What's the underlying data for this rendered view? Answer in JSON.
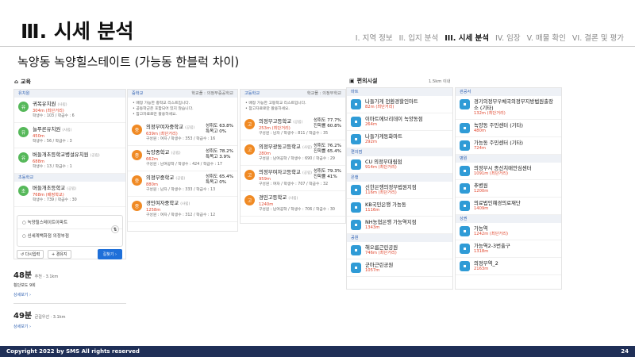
{
  "header": {
    "title": "Ⅲ. 시세 분석",
    "subtitle": "녹양동 녹양힐스테이트 (가능동 한블럭 차이)"
  },
  "nav": [
    "I. 지역 정보",
    "II. 입지 분석",
    "III. 시세 분석",
    "IV. 임장",
    "V. 매물 확인",
    "VI. 결론 및 평가"
  ],
  "edu": {
    "label": "교육",
    "kinder_label": "유치원",
    "schools": [
      {
        "name": "귀복유치원",
        "tag": "(사립)",
        "dist": "304m",
        "ex": "(최단거리)",
        "meta": "학생수 : 103 / 학급수 : 6"
      },
      {
        "name": "늘푸른유치원",
        "tag": "(사립)",
        "dist": "450m",
        "meta": "학생수 : 56 / 학급수 : 3"
      },
      {
        "name": "버들개초등학교병설유치원",
        "tag": "(공립)",
        "dist": "688m",
        "meta": "학생수 : 13 / 학급수 : 1"
      }
    ],
    "elem_label": "초등학교",
    "elem": {
      "name": "버들개초등학교",
      "tag": "(공립)",
      "dist": "768m",
      "ex": "(배정학교)",
      "meta": "학생수 : 739 / 학급수 : 30"
    }
  },
  "route": {
    "from": "녹양힐스테이트아파트",
    "to": "신세계백화점 의정부점",
    "b1": "다시입력",
    "b2": "경유지",
    "go": "길찾기 ›",
    "r1": "48분",
    "r1sub": "추천 · 3.1km",
    "r1d1": "횡단보도 9회",
    "r1d2": "상세보기 ›",
    "r2": "49분",
    "r2sub": "큰길우선 · 3.1km",
    "r2d": "상세보기 ›"
  },
  "middle": {
    "label": "중학교",
    "right": "학교폴 : 의정부중공학교",
    "notes": [
      "배정 가능한 중학교 리스트입니다.",
      "공동학군은 포함되어 있지 않습니다.",
      "참고자료로만 활용하세요."
    ],
    "items": [
      {
        "name": "의정부여자중학교",
        "tag": "(공립)",
        "dist": "639m",
        "ex": "(최단거리)",
        "meta": "구성원 : 여자 / 학생수 : 353 / 학급수 : 16",
        "r1": "성취도 63.8%",
        "r2": "특목고 0%"
      },
      {
        "name": "녹양중학교",
        "tag": "(공립)",
        "dist": "662m",
        "meta": "구성원 : 남여공학 / 학생수 : 424 / 학급수 : 17",
        "r1": "성취도 78.2%",
        "r2": "특목고 3.9%"
      },
      {
        "name": "의정부중학교",
        "tag": "(공립)",
        "dist": "880m",
        "meta": "구성원 : 남자 / 학생수 : 333 / 학급수 : 13",
        "r1": "성취도 65.4%",
        "r2": "특목고 0%"
      },
      {
        "name": "경민여자중학교",
        "tag": "(사립)",
        "dist": "1258m",
        "meta": "구성원 : 여자 / 학생수 : 312 / 학급수 : 12"
      }
    ]
  },
  "high": {
    "label": "고등학교",
    "right": "학교폴 : 의정부학교",
    "notes": [
      "배정 가능한 고등학교 리스트입니다.",
      "참고자료로만 활용하세요."
    ],
    "items": [
      {
        "name": "의정부고등학교",
        "tag": "(공립)",
        "dist": "253m",
        "ex": "(최단거리)",
        "meta": "구성원 : 남자 / 학생수 : 811 / 학급수 : 35",
        "r1": "성취도 77.7%",
        "r2": "진학률 60.8%"
      },
      {
        "name": "의정부광동고등학교",
        "tag": "(사립)",
        "dist": "280m",
        "meta": "구성원 : 남여공학 / 학생수 : 690 / 학급수 : 29",
        "r1": "성취도 76.2%",
        "r2": "진학률 65.4%"
      },
      {
        "name": "의정부여자고등학교",
        "tag": "(공립)",
        "dist": "959m",
        "meta": "구성원 : 여자 / 학생수 : 707 / 학급수 : 32",
        "r1": "성취도 79.3%",
        "r2": "진학률 41%"
      },
      {
        "name": "경민고등학교",
        "tag": "(사립)",
        "dist": "1240m",
        "meta": "구성원 : 남여공학 / 학생수 : 706 / 학급수 : 30"
      }
    ]
  },
  "amen": {
    "label": "편의시설",
    "range": "1.5km 이내",
    "c1": [
      {
        "cat": "마트"
      },
      {
        "name": "나들가게 천환경할인마트",
        "dist": "82m",
        "ex": "(최단거리)"
      },
      {
        "name": "이마트에브리데이 녹양동점",
        "dist": "264m"
      },
      {
        "name": "나들가게동화마트",
        "dist": "292m"
      },
      {
        "cat": "편의점"
      },
      {
        "name": "CU 의정부대림점",
        "dist": "914m",
        "ex": "(최단거리)"
      },
      {
        "cat": "은행"
      },
      {
        "name": "신한은행의정부법원지점",
        "dist": "116m",
        "ex": "(최단거리)"
      },
      {
        "name": "KB국민은행 가능동",
        "dist": "1116m"
      },
      {
        "name": "NH농협은행 가능역지점",
        "dist": "1343m"
      },
      {
        "cat": "공원"
      },
      {
        "name": "해오름근린공원",
        "dist": "746m",
        "ex": "(최단거리)"
      },
      {
        "name": "군마근린공원",
        "dist": "1057m"
      }
    ],
    "c2": [
      {
        "cat": "관공서"
      },
      {
        "name": "경기의정부우체국의정부지방법원출장소 (기타)",
        "dist": "132m",
        "ex": "(최단거리)"
      },
      {
        "name": "녹양동 주민센터 (기타)",
        "dist": "480m"
      },
      {
        "name": "가능동 주민센터 (기타)",
        "dist": "724m"
      },
      {
        "cat": "병원"
      },
      {
        "name": "의정부시 종선치매안심센터",
        "dist": "1091m",
        "ex": "(최단거리)"
      },
      {
        "name": "추병원",
        "dist": "1200m"
      },
      {
        "name": "의료법인혜경의료재단",
        "dist": "1409m"
      },
      {
        "cat": "상권"
      },
      {
        "name": "가능역",
        "dist": "1242m",
        "ex": "(최단거리)"
      },
      {
        "name": "가능역2-3번출구",
        "dist": "1318m"
      },
      {
        "name": "의정부역_2",
        "dist": "2163m"
      }
    ]
  },
  "footer": {
    "copyright": "Copyright 2022 by SMS All rights reserved",
    "page": "24"
  }
}
